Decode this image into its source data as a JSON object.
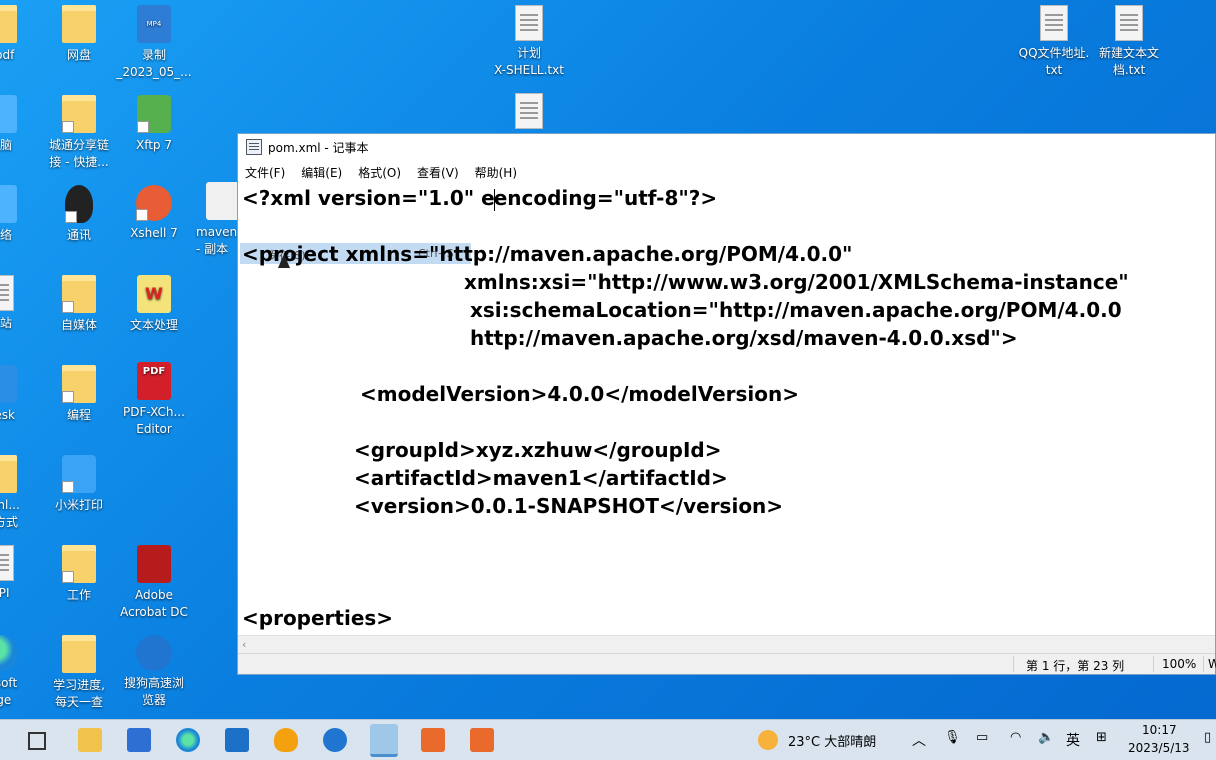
{
  "desktop": {
    "icons": [
      {
        "label": "&pdf",
        "type": "folder"
      },
      {
        "label": "网盘",
        "type": "folder"
      },
      {
        "label": "录制\n_2023_05_...",
        "type": "mp4"
      },
      {
        "label": "计划\nX-SHELL.txt",
        "type": "file"
      },
      {
        "label": "QQ文件地址.\ntxt",
        "type": "file"
      },
      {
        "label": "新建文本文\n档.txt",
        "type": "file"
      },
      {
        "label": "电脑",
        "type": "pc"
      },
      {
        "label": "城通分享链\n接 - 快捷...",
        "type": "folder"
      },
      {
        "label": "Xftp 7",
        "type": "xftp"
      },
      {
        "label": "网络",
        "type": "pc"
      },
      {
        "label": "通讯",
        "type": "qq"
      },
      {
        "label": "Xshell 7",
        "type": "xshell"
      },
      {
        "label": "maven\n- 副本",
        "type": "java"
      },
      {
        "label": "收站",
        "type": "file"
      },
      {
        "label": "自媒体",
        "type": "folder"
      },
      {
        "label": "文本处理",
        "type": "wps"
      },
      {
        "label": "Desk",
        "type": "blue"
      },
      {
        "label": "编程",
        "type": "folder"
      },
      {
        "label": "PDF-XCh...\nEditor",
        "type": "pdfx"
      },
      {
        "label": "ownl...\n捷方式",
        "type": "folder"
      },
      {
        "label": "小米打印",
        "type": "print"
      },
      {
        "label": "API",
        "type": "file"
      },
      {
        "label": "工作",
        "type": "folder"
      },
      {
        "label": "Adobe\nAcrobat DC",
        "type": "acrobat"
      },
      {
        "label": "rosoft\ndge",
        "type": "edge"
      },
      {
        "label": "学习进度,\n每天一查",
        "type": "folder"
      },
      {
        "label": "搜狗高速浏\n览器",
        "type": "sogou"
      }
    ]
  },
  "notepad": {
    "title": "pom.xml - 记事本",
    "menu": [
      "文件(F)",
      "编辑(E)",
      "格式(O)",
      "查看(V)",
      "帮助(H)"
    ],
    "lines": [
      "<?xml version=\"1.0\" e",
      "encoding=\"utf-8\"?>",
      "<project xmlns=\"http://maven.apache.org/POM/4.0.0\"",
      "xmlns:xsi=\"http://www.w3.org/2001/XMLSchema-instance\"",
      "xsi:schemaLocation=\"http://maven.apache.org/POM/4.0.0",
      "http://maven.apache.org/xsd/maven-4.0.0.xsd\">",
      "<modelVersion>4.0.0</modelVersion>",
      "<groupId>xyz.xzhuw</groupId>",
      "<artifactId>maven1</artifactId>",
      "<version>0.0.1-SNAPSHOT</version>",
      "<properties>"
    ],
    "context_menu": {
      "item": "保存(S)",
      "shortcut": "Ctrl+S"
    },
    "status": {
      "position": "第 1 行，第 23 列",
      "zoom": "100%",
      "extra": "W"
    }
  },
  "taskbar": {
    "weather": "23°C  大部晴朗",
    "ime": "英",
    "time": "10:17",
    "date": "2023/5/13"
  }
}
